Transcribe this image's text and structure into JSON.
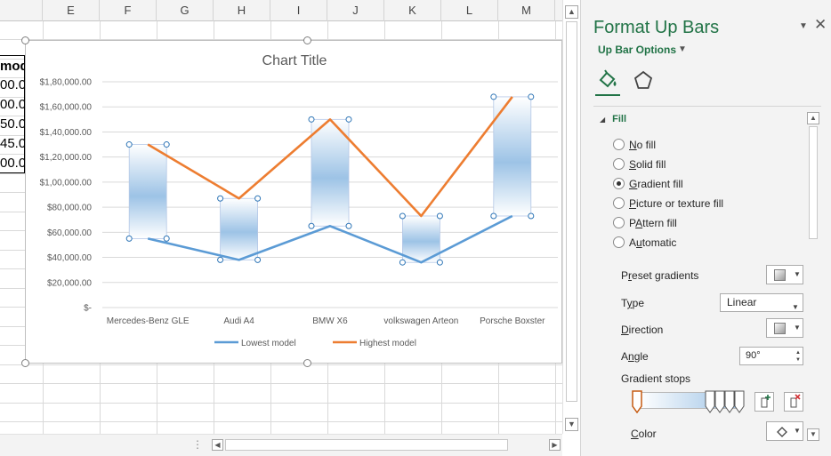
{
  "sheet": {
    "columns": [
      "E",
      "F",
      "G",
      "H",
      "I",
      "J",
      "K",
      "L",
      "M"
    ],
    "header_cell": "mod",
    "partial_cells": [
      "00.0",
      "00.0",
      "50.0",
      "45.0",
      "00.0"
    ]
  },
  "chart_data": {
    "type": "line",
    "title": "Chart Title",
    "categories": [
      "Mercedes-Benz GLE",
      "Audi A4",
      "BMW X6",
      "volkswagen Arteon",
      "Porsche Boxster"
    ],
    "series": [
      {
        "name": "Lowest model",
        "color": "#5b9bd5",
        "values": [
          55000,
          38000,
          65000,
          36000,
          73000
        ]
      },
      {
        "name": "Highest model",
        "color": "#ed7d31",
        "values": [
          130000,
          87000,
          150000,
          73000,
          168000
        ]
      }
    ],
    "up_bars": {
      "gradient_from": "#ffffff",
      "gradient_to": "#9dc3e6",
      "selected": true
    },
    "ylim": [
      0,
      180000
    ],
    "y_ticks": [
      "$-",
      "$20,000.00",
      "$40,000.00",
      "$60,000.00",
      "$80,000.00",
      "$1,00,000.00",
      "$1,20,000.00",
      "$1,40,000.00",
      "$1,60,000.00",
      "$1,80,000.00"
    ],
    "y_tick_values": [
      0,
      20000,
      40000,
      60000,
      80000,
      100000,
      120000,
      140000,
      160000,
      180000
    ],
    "legend_position": "bottom",
    "grid": true
  },
  "pane": {
    "title": "Format Up Bars",
    "subtitle": "Up Bar Options",
    "fill_section": "Fill",
    "radios": [
      {
        "mn": "N",
        "rest": "o fill",
        "checked": false
      },
      {
        "mn": "S",
        "rest": "olid fill",
        "checked": false
      },
      {
        "mn": "G",
        "rest": "radient fill",
        "checked": true
      },
      {
        "mn": "P",
        "rest": "icture or texture fill",
        "checked": false
      },
      {
        "mn": "A",
        "rest": "ttern fill",
        "pre": "P",
        "checked": false
      },
      {
        "mn": "u",
        "rest": "tomatic",
        "pre": "A",
        "checked": false
      }
    ],
    "preset_label": {
      "pre": "P",
      "mn": "r",
      "rest": "eset gradients"
    },
    "type_label": {
      "pre": "T",
      "mn": "y",
      "rest": "pe"
    },
    "type_value": "Linear",
    "direction_label": {
      "pre": "",
      "mn": "D",
      "rest": "irection"
    },
    "angle_label": {
      "pre": "A",
      "mn": "n",
      "rest": "gle"
    },
    "angle_value": "90°",
    "gradient_stops_label": "Gradient stops",
    "color_label": {
      "pre": "",
      "mn": "C",
      "rest": "olor"
    },
    "accent": "#217346"
  }
}
